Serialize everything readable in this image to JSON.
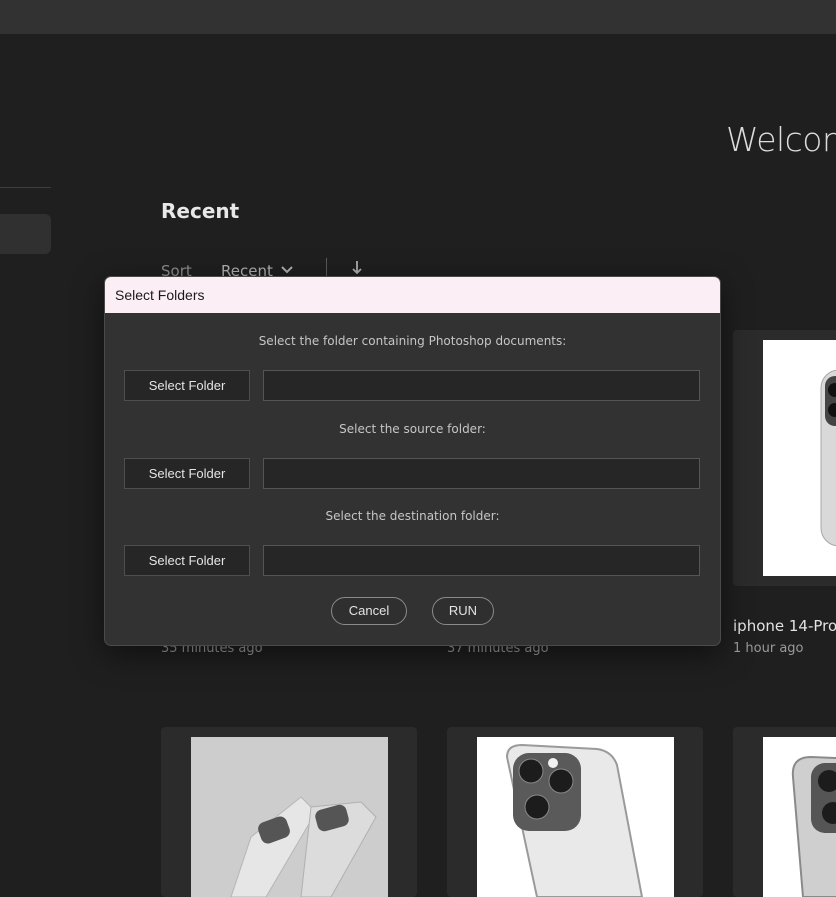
{
  "home": {
    "welcome_text": "Welcom",
    "recent_heading": "Recent",
    "sort_label": "Sort",
    "sort_value": "Recent",
    "sort_chevron_icon": "chevron-down-icon",
    "sort_direction_icon": "arrow-down-icon"
  },
  "cards": [
    {
      "time": "35 minutes ago"
    },
    {
      "time": "37 minutes ago"
    },
    {
      "title": "iphone 14-Pro",
      "time": "1 hour ago"
    }
  ],
  "dialog": {
    "title": "Select Folders",
    "prompt_psd": "Select the folder containing Photoshop documents:",
    "prompt_source": "Select the source folder:",
    "prompt_destination": "Select the destination folder:",
    "select_folder_label": "Select Folder",
    "psd_path": "",
    "source_path": "",
    "destination_path": "",
    "cancel_label": "Cancel",
    "run_label": "RUN"
  },
  "colors": {
    "background": "#1f1f1f",
    "topbar": "#323232",
    "dialog_bg": "#323232",
    "dialog_titlebar": "#fbeef4",
    "card_bg": "#2b2b2b"
  }
}
